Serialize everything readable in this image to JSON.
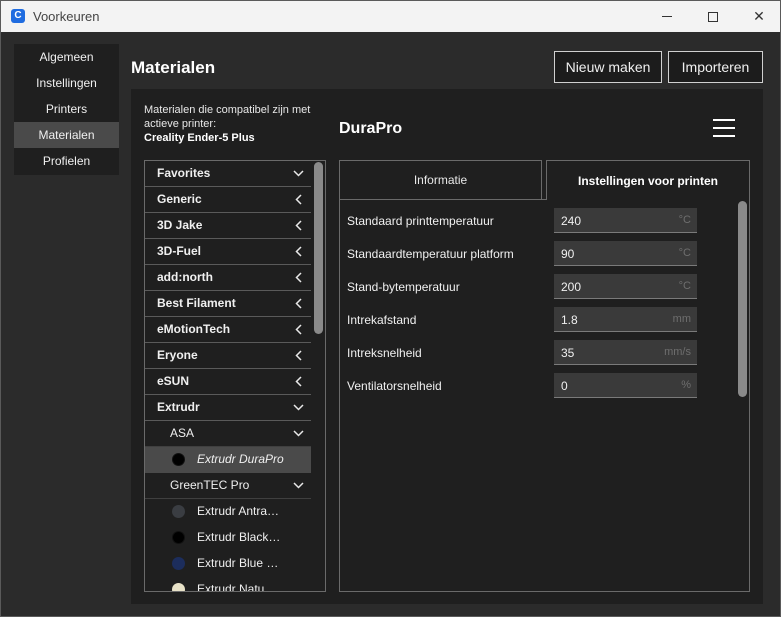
{
  "window": {
    "title": "Voorkeuren",
    "app_icon": "C"
  },
  "nav": {
    "items": [
      {
        "label": "Algemeen",
        "active": false
      },
      {
        "label": "Instellingen",
        "active": false
      },
      {
        "label": "Printers",
        "active": false
      },
      {
        "label": "Materialen",
        "active": true
      },
      {
        "label": "Profielen",
        "active": false
      }
    ]
  },
  "header": {
    "title": "Materialen",
    "new_button": "Nieuw maken",
    "import_button": "Importeren"
  },
  "compat": {
    "text": "Materialen die compatibel zijn met actieve printer:",
    "printer": "Creality Ender-5 Plus"
  },
  "material": {
    "name": "DuraPro"
  },
  "list": {
    "items": [
      {
        "label": "Favorites",
        "kind": "brand",
        "chevron": "down"
      },
      {
        "label": "Generic",
        "kind": "brand",
        "chevron": "left"
      },
      {
        "label": "3D Jake",
        "kind": "brand",
        "chevron": "left"
      },
      {
        "label": "3D-Fuel",
        "kind": "brand",
        "chevron": "left"
      },
      {
        "label": "add:north",
        "kind": "brand",
        "chevron": "left"
      },
      {
        "label": "Best Filament",
        "kind": "brand",
        "chevron": "left"
      },
      {
        "label": "eMotionTech",
        "kind": "brand",
        "chevron": "left"
      },
      {
        "label": "Eryone",
        "kind": "brand",
        "chevron": "left"
      },
      {
        "label": "eSUN",
        "kind": "brand",
        "chevron": "left"
      },
      {
        "label": "Extrudr",
        "kind": "brand",
        "chevron": "down"
      },
      {
        "label": "ASA",
        "kind": "sub",
        "chevron": "down"
      },
      {
        "label": "Extrudr DuraPro",
        "kind": "mat",
        "color": "#000000",
        "selected": true
      },
      {
        "label": "GreenTEC Pro",
        "kind": "sub",
        "chevron": "down"
      },
      {
        "label": "Extrudr Antra…",
        "kind": "mat",
        "color": "#3a3d42"
      },
      {
        "label": "Extrudr Black…",
        "kind": "mat",
        "color": "#000000"
      },
      {
        "label": "Extrudr Blue …",
        "kind": "mat",
        "color": "#1c2d5c"
      },
      {
        "label": "Extrudr Natu…",
        "kind": "mat",
        "color": "#e8e2c8"
      }
    ]
  },
  "tabs": {
    "info": "Informatie",
    "print": "Instellingen voor printen"
  },
  "settings": [
    {
      "label": "Standaard printtemperatuur",
      "value": "240",
      "unit": "°C"
    },
    {
      "label": "Standaardtemperatuur platform",
      "value": "90",
      "unit": "°C"
    },
    {
      "label": "Stand-bytemperatuur",
      "value": "200",
      "unit": "°C"
    },
    {
      "label": "Intrekafstand",
      "value": "1.8",
      "unit": "mm"
    },
    {
      "label": "Intreksnelheid",
      "value": "35",
      "unit": "mm/s"
    },
    {
      "label": "Ventilatorsnelheid",
      "value": "0",
      "unit": "%"
    }
  ]
}
